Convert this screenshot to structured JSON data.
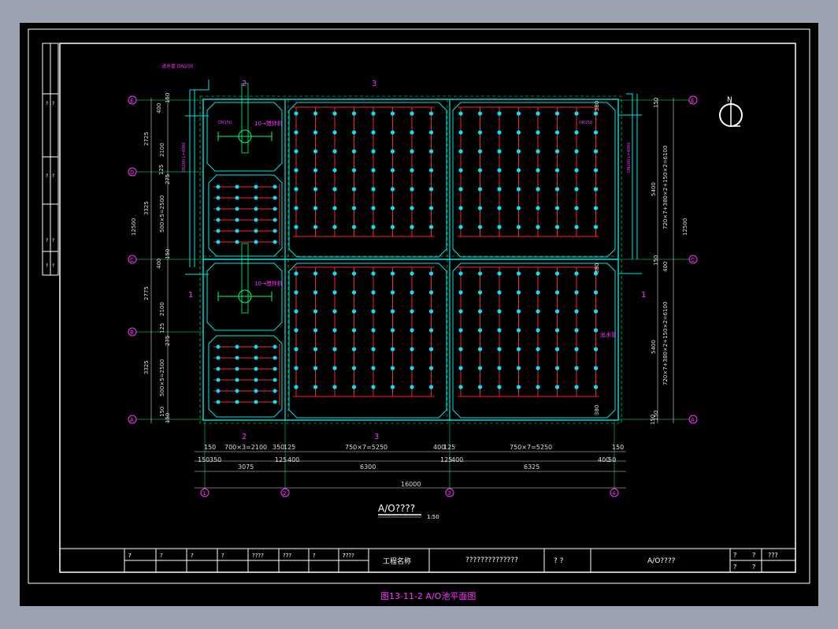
{
  "colors": {
    "frame": "#ffffff",
    "wall": "#00e5e5",
    "red": "#ff2222",
    "dot": "#00e5ff",
    "green": "#00ff66",
    "magenta": "#ff33ff",
    "yellow": "#ffff33",
    "dim": "#dddddd",
    "page_bg": "#9ba3b2"
  },
  "drawing": {
    "title": "A/O????",
    "scale": "1:50",
    "caption": "图13-11-2  A/O池平面图",
    "north_label": "N",
    "labels": {
      "feed_top": "10→搅拌机",
      "feed_bottom": "10→搅拌机",
      "pipe_right": "出水管",
      "inlet_top": "进水管 DN200",
      "section_2": "2",
      "section_3": "3",
      "section_1": "1",
      "riser_1": "DN150",
      "riser_2": "DN150",
      "vpipe": "DN200 L=4000"
    },
    "dims_bottom_row1": [
      "150",
      "700×3=2100",
      "350",
      "125",
      "750×7=5250",
      "400",
      "125",
      "750×7=5250",
      "150"
    ],
    "dims_bottom_row2": [
      "150",
      "350",
      "125",
      "400",
      "125",
      "400",
      "400",
      "50"
    ],
    "dims_bottom_row3": [
      "3075",
      "6300",
      "6325"
    ],
    "dims_bottom_total": "16000",
    "dims_left": [
      "150",
      "400",
      "2725",
      "2100",
      "125",
      "275",
      "3325",
      "500×5=2500",
      "12500",
      "400",
      "150",
      "2775",
      "2100",
      "125",
      "275",
      "3325",
      "500×5=2500",
      "150",
      "150"
    ],
    "dims_right": [
      "150",
      "380",
      "5400",
      "720×7+380×2+150×2=6100",
      "12500",
      "150",
      "400",
      "380",
      "5400",
      "720×7+380×2+150×2=6100",
      "150",
      "150",
      "380"
    ],
    "axis_left": [
      "E",
      "D",
      "C",
      "B",
      "A"
    ],
    "axis_right": [
      "E",
      "C",
      "A"
    ],
    "axis_bottom": [
      "1",
      "2",
      "3",
      "4"
    ]
  },
  "title_block": {
    "cells": [
      "?",
      "?",
      "?",
      "?",
      "????",
      "???",
      "?",
      "?",
      "?",
      "?",
      "?",
      "????"
    ],
    "project_label": "工程名称",
    "project_value": "??????????????",
    "design_label": "?     ?",
    "drawing_name": "A/O????",
    "right_top": [
      "?",
      "?",
      "???"
    ],
    "right_bot": [
      "?",
      "?"
    ]
  },
  "side_strip": [
    "?",
    "?",
    "?",
    "?",
    "?",
    "?",
    "?",
    "?"
  ]
}
